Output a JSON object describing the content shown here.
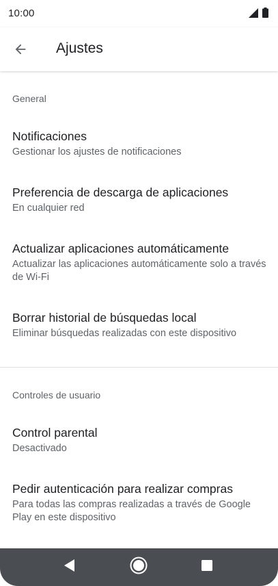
{
  "status_bar": {
    "time": "10:00",
    "icons": [
      "signal-icon",
      "battery-icon"
    ]
  },
  "app_bar": {
    "back_icon": "arrow-back-icon",
    "title": "Ajustes"
  },
  "sections": [
    {
      "header": "General",
      "items": [
        {
          "title": "Notificaciones",
          "subtitle": "Gestionar los ajustes de notificaciones"
        },
        {
          "title": "Preferencia de descarga de aplicaciones",
          "subtitle": "En cualquier red"
        },
        {
          "title": "Actualizar aplicaciones automáticamente",
          "subtitle": "Actualizar las aplicaciones automáticamente solo a través de Wi-Fi"
        },
        {
          "title": "Borrar historial de búsquedas local",
          "subtitle": "Eliminar búsquedas realizadas con este dispositivo"
        }
      ]
    },
    {
      "header": "Controles de usuario",
      "items": [
        {
          "title": "Control parental",
          "subtitle": "Desactivado"
        },
        {
          "title": "Pedir autenticación para realizar compras",
          "subtitle": "Para todas las compras realizadas a través de Google Play en este dispositivo"
        }
      ]
    }
  ],
  "nav_bar": {
    "icons": [
      "back-triangle-icon",
      "home-circle-icon",
      "recents-square-icon"
    ]
  },
  "colors": {
    "text_primary": "#202124",
    "text_secondary": "#5f6368",
    "nav_background": "#4a4d52",
    "divider": "#e0e0e0"
  }
}
